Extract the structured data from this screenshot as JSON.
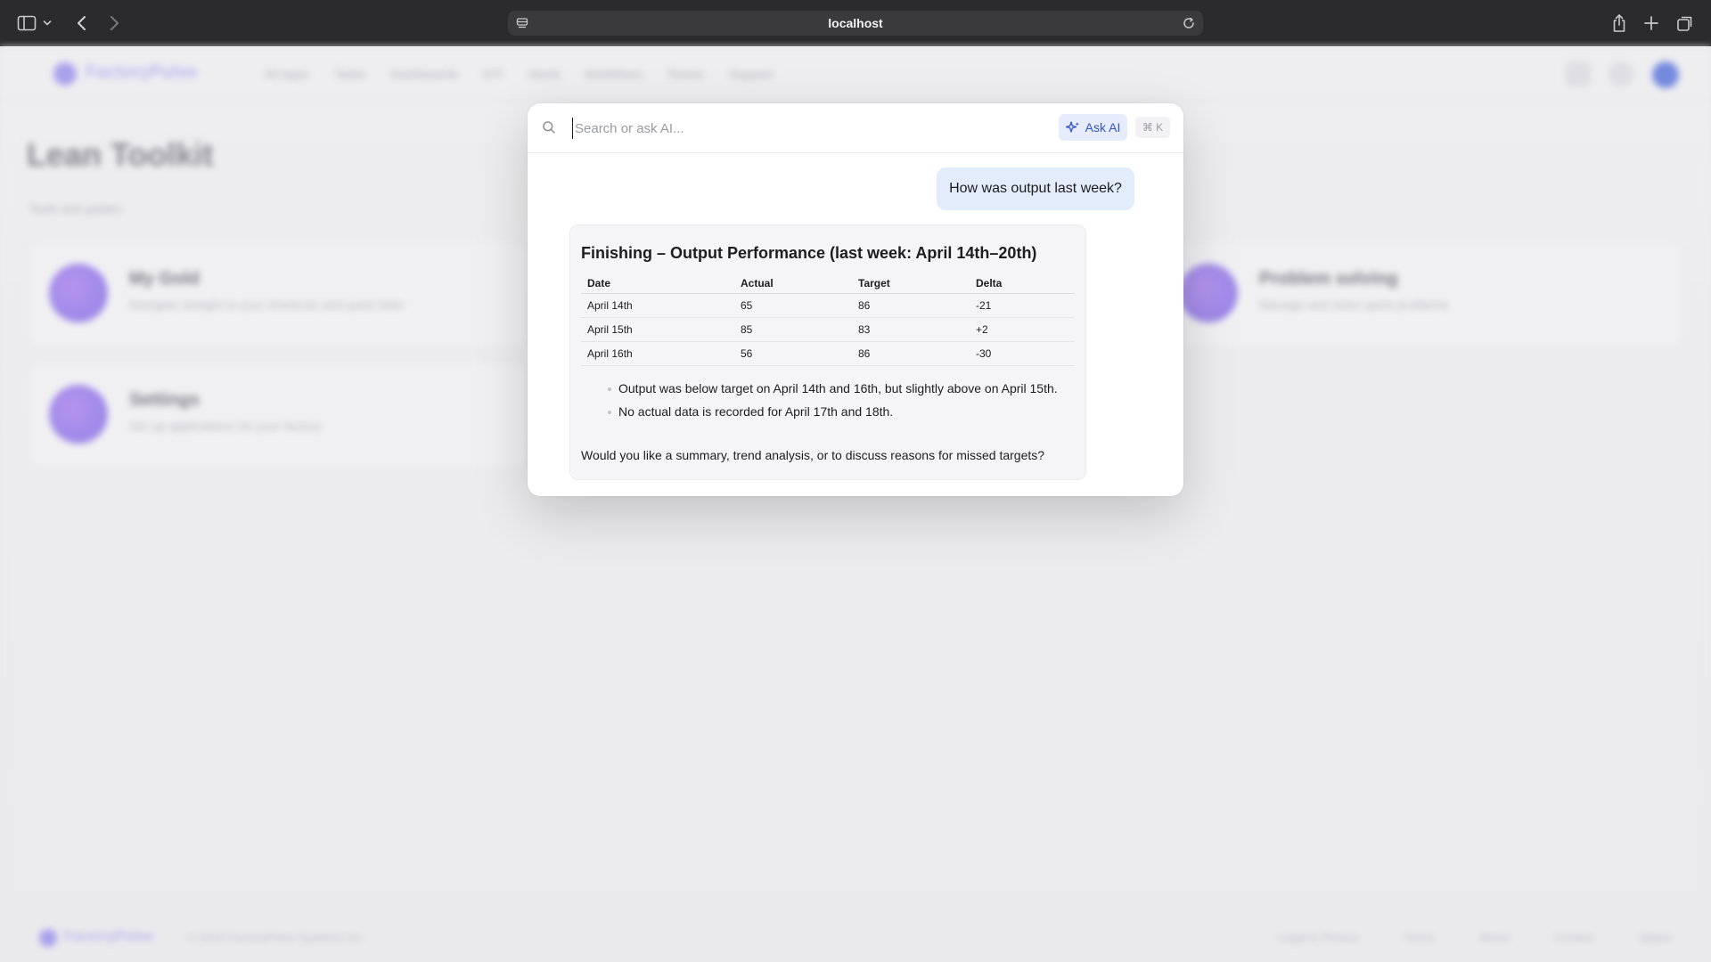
{
  "browser": {
    "address": "localhost"
  },
  "background_app": {
    "logo_text": "FactoryPulse",
    "nav": [
      "All Apps",
      "Tasks",
      "Dashboards",
      "KPI",
      "Alerts",
      "Workflows",
      "Teams",
      "Support"
    ],
    "page_title": "Lean Toolkit",
    "page_subtitle": "Tools and guides",
    "cards": [
      {
        "title": "My Gold",
        "desc": "Navigate straight to your shortcuts and quick links"
      },
      {
        "title": "Problem solving",
        "desc": "Manage and solve quick problems"
      },
      {
        "title": "Settings",
        "desc": "Set up applications for your factory"
      }
    ],
    "footer": {
      "name": "FactoryPulse",
      "copyright": "© 2025 FactoryPulse Systems Inc.",
      "links": [
        "Legal & Privacy",
        "Terms",
        "About",
        "Contact",
        "Status"
      ]
    }
  },
  "modal": {
    "search_placeholder": "Search or ask AI...",
    "ask_ai_label": "Ask AI",
    "shortcut_hint": "⌘ K",
    "user_message": "How was output last week?",
    "ai_response": {
      "title": "Finishing – Output Performance (last week: April 14th–20th)",
      "table": {
        "headers": [
          "Date",
          "Actual",
          "Target",
          "Delta"
        ],
        "rows": [
          [
            "April 14th",
            "65",
            "86",
            "-21"
          ],
          [
            "April 15th",
            "85",
            "83",
            "+2"
          ],
          [
            "April 16th",
            "56",
            "86",
            "-30"
          ]
        ]
      },
      "bullets": [
        "Output was below target on April 14th and 16th, but slightly above on April 15th.",
        "No actual data is recorded for April 17th and 18th."
      ],
      "followup": "Would you like a summary, trend analysis, or to discuss reasons for missed targets?"
    }
  },
  "icons": {
    "sidebar_toggle": "sidebar-icon",
    "back": "chevron-left-icon",
    "forward": "chevron-right-icon",
    "share": "share-icon",
    "new_tab": "plus-icon",
    "tabs": "tabs-icon",
    "search": "search-icon",
    "sparkle": "sparkle-icon"
  },
  "colors": {
    "browser_chrome": "#2b2b2e",
    "ask_ai_bg": "#e6ecfb",
    "ask_ai_text": "#3155c9",
    "user_bubble": "#e3ecfb",
    "ai_card": "#f5f5f7"
  }
}
